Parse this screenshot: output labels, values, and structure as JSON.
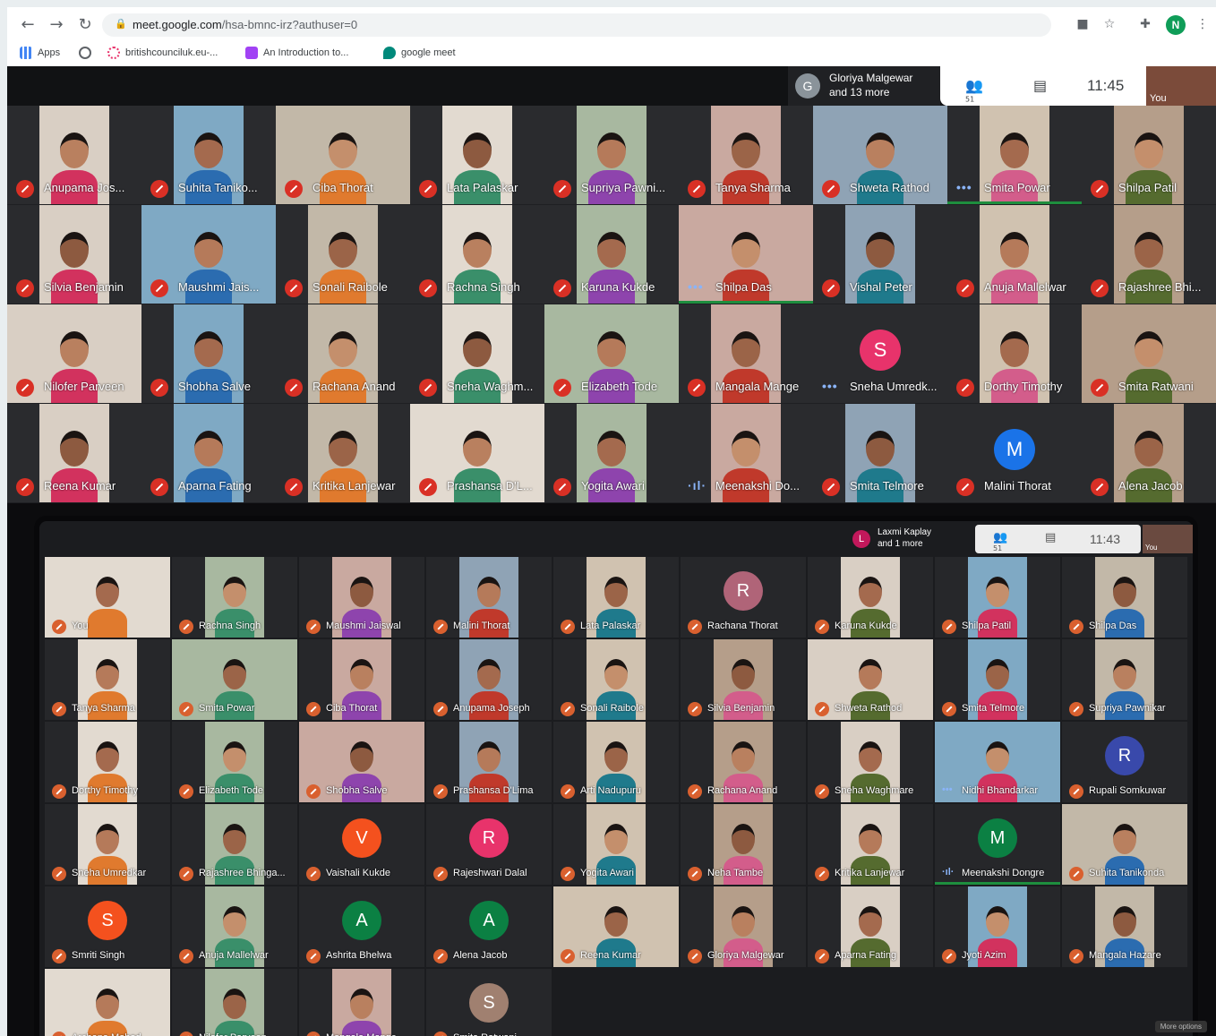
{
  "browser": {
    "url_domain": "meet.google.com",
    "url_path": "/hsa-bmnc-irz?authuser=0",
    "profile_initial": "N",
    "bookmarks": [
      "Apps",
      "britishcounciluk.eu-...",
      "An Introduction to...",
      "google meet"
    ]
  },
  "meet_top": {
    "speaker_initial": "G",
    "speaker_name": "Gloriya Malgewar",
    "speaker_more": "and 13 more",
    "participant_count": "51",
    "clock": "11:45",
    "self_label": "You",
    "participants": [
      {
        "name": "Anupama Jos...",
        "state": "muted"
      },
      {
        "name": "Suhita Taniko...",
        "state": "muted"
      },
      {
        "name": "Ciba Thorat",
        "state": "muted"
      },
      {
        "name": "Lata Palaskar",
        "state": "muted"
      },
      {
        "name": "Supriya Pawni...",
        "state": "muted"
      },
      {
        "name": "Tanya Sharma",
        "state": "muted"
      },
      {
        "name": "Shweta Rathod",
        "state": "muted"
      },
      {
        "name": "Smita Powar",
        "state": "active"
      },
      {
        "name": "Shilpa Patil",
        "state": "muted"
      },
      {
        "name": "Silvia Benjamin",
        "state": "muted"
      },
      {
        "name": "Maushmi Jais...",
        "state": "muted"
      },
      {
        "name": "Sonali Raibole",
        "state": "muted"
      },
      {
        "name": "Rachna Singh",
        "state": "muted"
      },
      {
        "name": "Karuna Kukde",
        "state": "muted"
      },
      {
        "name": "Shilpa Das",
        "state": "active"
      },
      {
        "name": "Vishal Peter",
        "state": "muted"
      },
      {
        "name": "Anuja Mallelwar",
        "state": "muted"
      },
      {
        "name": "Rajashree Bhi...",
        "state": "muted"
      },
      {
        "name": "Nilofer Parveen",
        "state": "muted"
      },
      {
        "name": "Shobha Salve",
        "state": "muted"
      },
      {
        "name": "Rachana Anand",
        "state": "muted"
      },
      {
        "name": "Sneha Waghm...",
        "state": "muted"
      },
      {
        "name": "Elizabeth Tode",
        "state": "muted"
      },
      {
        "name": "Mangala Mange",
        "state": "muted"
      },
      {
        "name": "Sneha Umredk...",
        "state": "active",
        "initial": "S"
      },
      {
        "name": "Dorthy Timothy",
        "state": "muted"
      },
      {
        "name": "Smita Ratwani",
        "state": "muted"
      },
      {
        "name": "Reena Kumar",
        "state": "muted"
      },
      {
        "name": "Aparna Fating",
        "state": "muted"
      },
      {
        "name": "Kritika Lanjewar",
        "state": "muted"
      },
      {
        "name": "Prashansa D'L...",
        "state": "muted"
      },
      {
        "name": "Yogita Awari",
        "state": "muted"
      },
      {
        "name": "Meenakshi Do...",
        "state": "speaking"
      },
      {
        "name": "Smita Telmore",
        "state": "muted"
      },
      {
        "name": "Malini Thorat",
        "state": "muted",
        "initial": "M"
      },
      {
        "name": "Alena Jacob",
        "state": "muted"
      }
    ]
  },
  "meet_photo": {
    "speaker_initial": "L",
    "speaker_name": "Laxmi Kaplay",
    "speaker_more": "and 1 more",
    "participant_count": "51",
    "clock": "11:43",
    "self_label": "You",
    "participants": [
      {
        "name": "You"
      },
      {
        "name": "Rachna Singh"
      },
      {
        "name": "Maushmi Jaiswal"
      },
      {
        "name": "Malini Thorat"
      },
      {
        "name": "Lata Palaskar"
      },
      {
        "name": "Rachana Thorat",
        "initial": "R"
      },
      {
        "name": "Karuna Kukde"
      },
      {
        "name": "Shilpa Patil"
      },
      {
        "name": "Shilpa Das"
      },
      {
        "name": "Tanya Sharma"
      },
      {
        "name": "Smita Powar"
      },
      {
        "name": "Ciba Thorat"
      },
      {
        "name": "Anupama Joseph"
      },
      {
        "name": "Sonali Raibole"
      },
      {
        "name": "Silvia Benjamin"
      },
      {
        "name": "Shweta Rathod"
      },
      {
        "name": "Smita Telmore"
      },
      {
        "name": "Supriya Pawnikar"
      },
      {
        "name": "Dorthy Timothy"
      },
      {
        "name": "Elizabeth Tode"
      },
      {
        "name": "Shobha Salve"
      },
      {
        "name": "Prashansa D'Lima"
      },
      {
        "name": "Arti Nadupuru"
      },
      {
        "name": "Rachana Anand"
      },
      {
        "name": "Sneha Waghmare"
      },
      {
        "name": "Nidhi Bhandarkar"
      },
      {
        "name": "Rupali Somkuwar",
        "initial": "R"
      },
      {
        "name": "Sneha Umredkar"
      },
      {
        "name": "Rajashree Bhinga..."
      },
      {
        "name": "Vaishali Kukde",
        "initial": "V"
      },
      {
        "name": "Rajeshwari Dalal",
        "initial": "R"
      },
      {
        "name": "Yogita Awari"
      },
      {
        "name": "Neha Tambe"
      },
      {
        "name": "Kritika Lanjewar"
      },
      {
        "name": "Meenakshi Dongre",
        "initial": "M"
      },
      {
        "name": "Suhita Tanikonda"
      },
      {
        "name": "Smriti Singh",
        "initial": "S"
      },
      {
        "name": "Anuja Mallelwar"
      },
      {
        "name": "Ashrita Bhelwa",
        "initial": "A"
      },
      {
        "name": "Alena Jacob",
        "initial": "A"
      },
      {
        "name": "Reena Kumar"
      },
      {
        "name": "Gloriya Malgewar"
      },
      {
        "name": "Aparna Fating"
      },
      {
        "name": "Jyoti Azim"
      },
      {
        "name": "Mangala Hazare"
      },
      {
        "name": "Archana Mahod"
      },
      {
        "name": "Nilofer Parveen"
      },
      {
        "name": "Mangala Mange"
      },
      {
        "name": "Smita Ratwani",
        "initial": "S"
      }
    ],
    "more_options": "More options"
  },
  "colors": {
    "mute_red": "#d93025",
    "speaking_green": "#1e8e3e",
    "dots_blue": "#8ab4f8",
    "avatar_pink": "#e8336b",
    "avatar_blue": "#1a73e8",
    "avatar_orange": "#f4511e",
    "avatar_green": "#0b8043",
    "avatar_mauve": "#b06478",
    "avatar_taupe": "#a08070"
  },
  "icons": {
    "back": "arrow-left-icon",
    "forward": "arrow-right-icon",
    "reload": "reload-icon",
    "lock": "lock-icon",
    "camera": "camera-icon",
    "star": "star-icon",
    "extensions": "puzzle-icon",
    "menu": "kebab-menu-icon",
    "people": "people-icon",
    "chat": "chat-icon",
    "mic_off": "mic-off-icon"
  }
}
